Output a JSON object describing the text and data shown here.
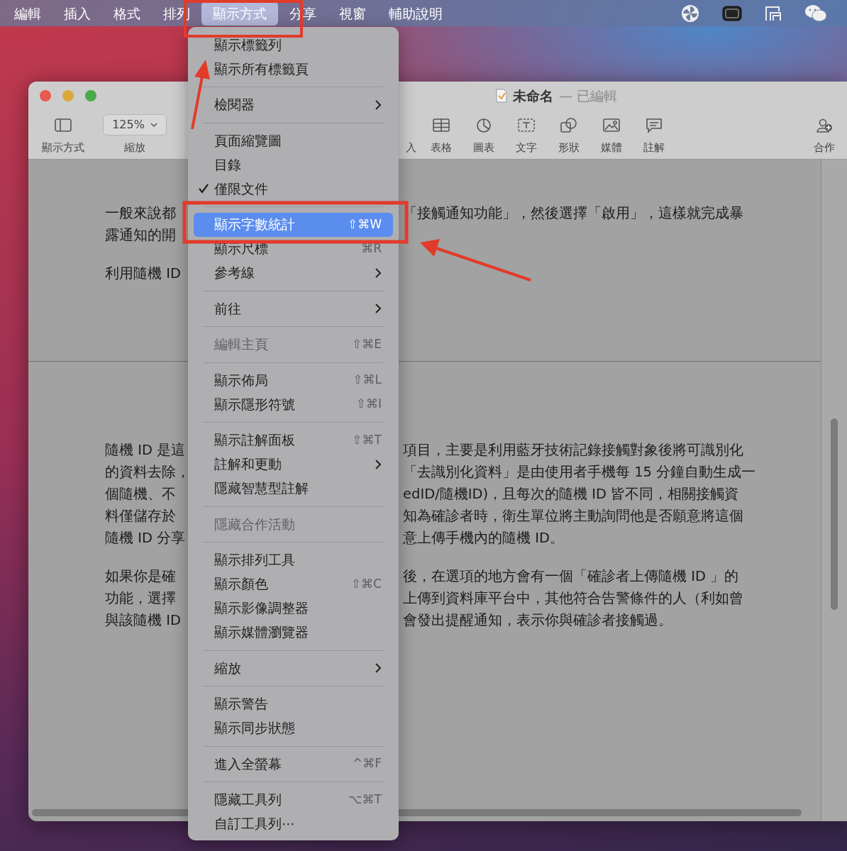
{
  "menu_bar": {
    "items": [
      {
        "label": "編輯",
        "selected": false
      },
      {
        "label": "插入",
        "selected": false
      },
      {
        "label": "格式",
        "selected": false
      },
      {
        "label": "排列",
        "selected": false
      },
      {
        "label": "顯示方式",
        "selected": true
      },
      {
        "label": "分享",
        "selected": false
      },
      {
        "label": "視窗",
        "selected": false
      },
      {
        "label": "輔助說明",
        "selected": false
      }
    ]
  },
  "window": {
    "title": "未命名",
    "status": "— 已編輯"
  },
  "toolbar": [
    {
      "label": "顯示方式",
      "kind": "sidebar"
    },
    {
      "label": "縮放",
      "kind": "zoom",
      "value": "125%"
    },
    {
      "label": "入",
      "kind": "partial"
    },
    {
      "label": "表格",
      "kind": "table"
    },
    {
      "label": "圖表",
      "kind": "chart"
    },
    {
      "label": "文字",
      "kind": "text"
    },
    {
      "label": "形狀",
      "kind": "shape"
    },
    {
      "label": "媒體",
      "kind": "media"
    },
    {
      "label": "註解",
      "kind": "comment"
    },
    {
      "label": "合作",
      "kind": "collaborate"
    }
  ],
  "document": {
    "pages": [
      {
        "paragraphs": [
          {
            "lines": [
              {
                "left": "一般來說都",
                "right": "「接觸通知功能」，然後選擇「啟用」，這樣就完成暴"
              },
              {
                "left": "露通知的開"
              }
            ]
          },
          {
            "lines": [
              {
                "left": "利用隨機 ID"
              }
            ]
          }
        ]
      },
      {
        "paragraphs": [
          {
            "lines": [
              {
                "left": "隨機 ID 是這",
                "right": "項目，主要是利用藍牙技術記錄接觸對象後將可識別化"
              },
              {
                "left": "的資料去除，",
                "right": "「去識別化資料」是由使用者手機每 15 分鐘自動生成一"
              },
              {
                "left": "個隨機、不",
                "right": "edID/隨機ID)，且每次的隨機 ID 皆不同，相關接觸資"
              },
              {
                "left": "料僅儲存於",
                "right": "知為確診者時，衛生單位將主動詢問他是否願意將這個"
              },
              {
                "left": "隨機 ID 分享",
                "right": "意上傳手機內的隨機 ID。"
              }
            ]
          },
          {
            "lines": [
              {
                "left": "如果你是確",
                "right": "後，在選項的地方會有一個「確診者上傳隨機 ID 」的"
              },
              {
                "left": "功能，選擇",
                "right": "上傳到資料庫平台中，其他符合告警條件的人（利如曾"
              },
              {
                "left": "與該隨機 ID",
                "right": "會發出提醒通知，表示你與確診者接觸過。"
              }
            ]
          }
        ]
      }
    ]
  },
  "menu": {
    "items": [
      {
        "kind": "item",
        "label": "顯示標籤列",
        "checked": false,
        "selected": false,
        "disabled": false,
        "submenu": false
      },
      {
        "kind": "item",
        "label": "顯示所有標籤頁",
        "checked": false,
        "selected": false,
        "disabled": false,
        "submenu": false
      },
      {
        "kind": "separator"
      },
      {
        "kind": "item",
        "label": "檢閱器",
        "checked": false,
        "selected": false,
        "disabled": false,
        "submenu": true
      },
      {
        "kind": "separator"
      },
      {
        "kind": "item",
        "label": "頁面縮覽圖",
        "checked": false,
        "selected": false,
        "disabled": false,
        "submenu": false
      },
      {
        "kind": "item",
        "label": "目錄",
        "checked": false,
        "selected": false,
        "disabled": false,
        "submenu": false
      },
      {
        "kind": "item",
        "label": "僅限文件",
        "checked": true,
        "selected": false,
        "disabled": false,
        "submenu": false
      },
      {
        "kind": "separator"
      },
      {
        "kind": "item",
        "label": "顯示字數統計",
        "shortcut": "⇧⌘W",
        "checked": false,
        "selected": true,
        "disabled": false,
        "submenu": false
      },
      {
        "kind": "item",
        "label": "顯示尺標",
        "shortcut": "⌘R",
        "checked": false,
        "selected": false,
        "disabled": false,
        "submenu": false
      },
      {
        "kind": "item",
        "label": "參考線",
        "checked": false,
        "selected": false,
        "disabled": false,
        "submenu": true
      },
      {
        "kind": "separator"
      },
      {
        "kind": "item",
        "label": "前往",
        "checked": false,
        "selected": false,
        "disabled": false,
        "submenu": true
      },
      {
        "kind": "separator"
      },
      {
        "kind": "item",
        "label": "編輯主頁",
        "shortcut": "⇧⌘E",
        "checked": false,
        "selected": false,
        "disabled": true,
        "submenu": false
      },
      {
        "kind": "separator"
      },
      {
        "kind": "item",
        "label": "顯示佈局",
        "shortcut": "⇧⌘L",
        "checked": false,
        "selected": false,
        "disabled": false,
        "submenu": false
      },
      {
        "kind": "item",
        "label": "顯示隱形符號",
        "shortcut": "⇧⌘I",
        "checked": false,
        "selected": false,
        "disabled": false,
        "submenu": false
      },
      {
        "kind": "separator"
      },
      {
        "kind": "item",
        "label": "顯示註解面板",
        "shortcut": "⇧⌘T",
        "checked": false,
        "selected": false,
        "disabled": false,
        "submenu": false
      },
      {
        "kind": "item",
        "label": "註解和更動",
        "checked": false,
        "selected": false,
        "disabled": false,
        "submenu": true
      },
      {
        "kind": "item",
        "label": "隱藏智慧型註解",
        "checked": false,
        "selected": false,
        "disabled": false,
        "submenu": false
      },
      {
        "kind": "separator"
      },
      {
        "kind": "item",
        "label": "隱藏合作活動",
        "checked": false,
        "selected": false,
        "disabled": true,
        "submenu": false
      },
      {
        "kind": "separator"
      },
      {
        "kind": "item",
        "label": "顯示排列工具",
        "checked": false,
        "selected": false,
        "disabled": false,
        "submenu": false
      },
      {
        "kind": "item",
        "label": "顯示顏色",
        "shortcut": "⇧⌘C",
        "checked": false,
        "selected": false,
        "disabled": false,
        "submenu": false
      },
      {
        "kind": "item",
        "label": "顯示影像調整器",
        "checked": false,
        "selected": false,
        "disabled": false,
        "submenu": false
      },
      {
        "kind": "item",
        "label": "顯示媒體瀏覽器",
        "checked": false,
        "selected": false,
        "disabled": false,
        "submenu": false
      },
      {
        "kind": "separator"
      },
      {
        "kind": "item",
        "label": "縮放",
        "checked": false,
        "selected": false,
        "disabled": false,
        "submenu": true
      },
      {
        "kind": "separator"
      },
      {
        "kind": "item",
        "label": "顯示警告",
        "checked": false,
        "selected": false,
        "disabled": false,
        "submenu": false
      },
      {
        "kind": "item",
        "label": "顯示同步狀態",
        "checked": false,
        "selected": false,
        "disabled": false,
        "submenu": false
      },
      {
        "kind": "separator"
      },
      {
        "kind": "item",
        "label": "進入全螢幕",
        "shortcut": "^⌘F",
        "checked": false,
        "selected": false,
        "disabled": false,
        "submenu": false
      },
      {
        "kind": "separator"
      },
      {
        "kind": "item",
        "label": "隱藏工具列",
        "shortcut": "⌥⌘T",
        "checked": false,
        "selected": false,
        "disabled": false,
        "submenu": false
      },
      {
        "kind": "item",
        "label": "自訂工具列⋯",
        "checked": false,
        "selected": false,
        "disabled": false,
        "submenu": false
      }
    ]
  }
}
